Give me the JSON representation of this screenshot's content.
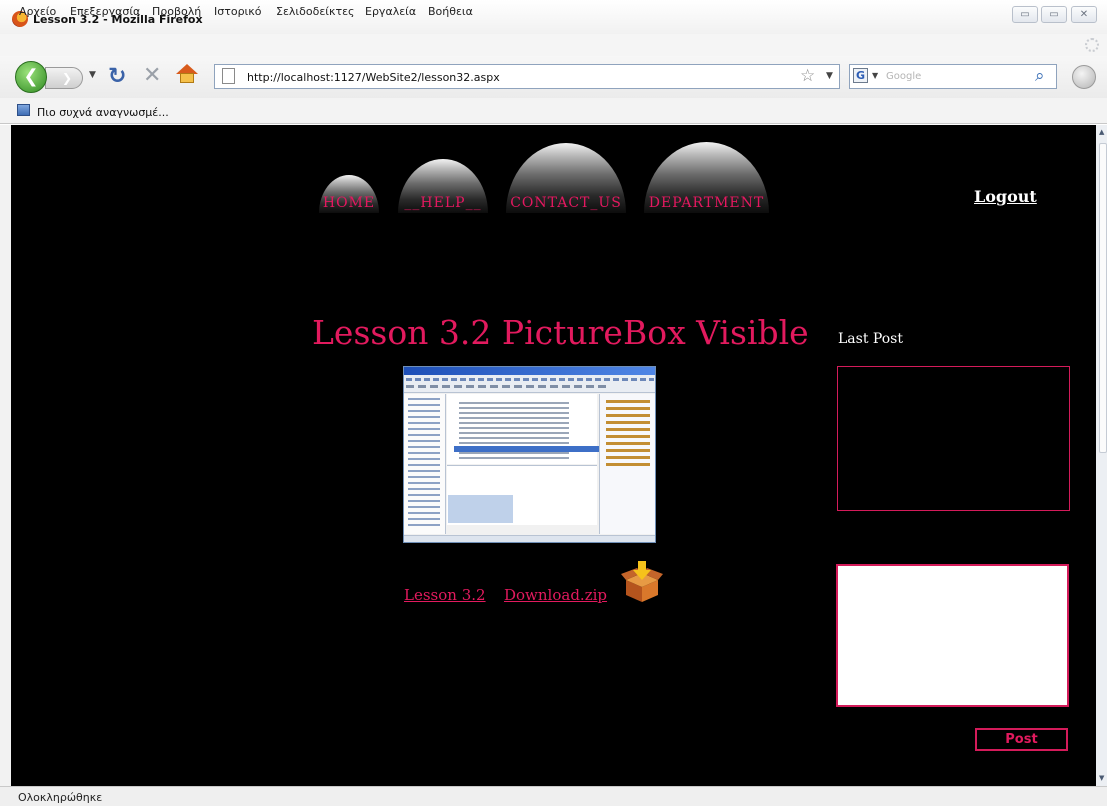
{
  "window": {
    "title": "Lesson 3.2 - Mozilla Firefox",
    "controls": {
      "minimize": "▭",
      "maximize": "▭",
      "close": "✕"
    }
  },
  "menubar": {
    "items": [
      "Αρχείο",
      "Επεξεργασία",
      "Προβολή",
      "Ιστορικό",
      "Σελιδοδείκτες",
      "Εργαλεία",
      "Βοήθεια"
    ]
  },
  "navbar": {
    "url": "http://localhost:1127/WebSite2/lesson32.aspx",
    "search_placeholder": "Google"
  },
  "bookmarks": {
    "item": "Πιο συχνά αναγνωσμέ..."
  },
  "page": {
    "nav": [
      "HOME",
      "__HELP__",
      "CONTACT_US",
      "DEPARTMENT"
    ],
    "logout": "Logout",
    "lesson_title": "Lesson 3.2 PictureBox Visible",
    "last_post_label": "Last Post",
    "links": {
      "lesson": "Lesson 3.2",
      "download": "Download.zip"
    },
    "post_button": "Post",
    "colors": {
      "accent": "#e21a5e",
      "background": "#000000",
      "link_border": "#d41b5a"
    }
  },
  "status": {
    "text": "Ολοκληρώθηκε"
  },
  "icons": [
    "firefox-icon",
    "back-icon",
    "forward-icon",
    "reload-icon",
    "stop-icon",
    "home-icon",
    "page-icon",
    "star-icon",
    "google-icon",
    "search-icon",
    "persona-icon",
    "bookmark-icon",
    "download-box-icon"
  ]
}
